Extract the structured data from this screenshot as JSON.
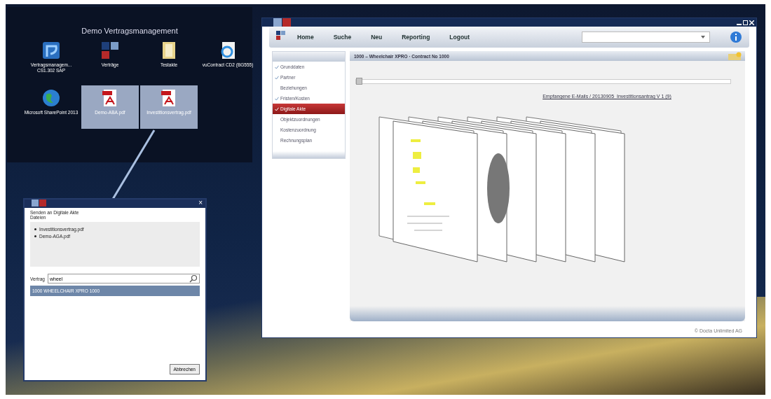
{
  "desktop": {
    "group_title": "Demo Vertragsmanagement",
    "icons": [
      {
        "label": "Vertragsmanagem... CS1.302 SAP",
        "kind": "app",
        "selected": false
      },
      {
        "label": "Verträge",
        "kind": "tiles",
        "selected": false
      },
      {
        "label": "Testakte",
        "kind": "folder",
        "selected": false
      },
      {
        "label": "vuContract CD2 (BG555)",
        "kind": "browser",
        "selected": false
      },
      {
        "label": "Microsoft SharePoint 2013",
        "kind": "globe",
        "selected": false
      },
      {
        "label": "Demo-ABA.pdf",
        "kind": "pdf",
        "selected": true
      },
      {
        "label": "Investitionsvertrag.pdf",
        "kind": "pdf",
        "selected": true
      }
    ]
  },
  "dialog": {
    "close": "×",
    "title": "Senden an Digitale Akte",
    "files_label": "Dateien",
    "files": [
      "Investitionsvertrag.pdf",
      "Demo-AGA.pdf"
    ],
    "contract_label": "Vertrag",
    "contract_value": "wheel",
    "results": [
      {
        "label": "1000 WHEELCHAIR XPRO 1000",
        "selected": true
      }
    ],
    "cancel_button": "Abbrechen"
  },
  "window": {
    "nav": [
      "Home",
      "Suche",
      "Neu",
      "Reporting",
      "Logout"
    ],
    "sidebar": [
      {
        "label": "Grunddaten",
        "checked": true,
        "selected": false
      },
      {
        "label": "Partner",
        "checked": true,
        "selected": false
      },
      {
        "label": "Beziehungen",
        "checked": false,
        "selected": false
      },
      {
        "label": "Fristen/Kosten",
        "checked": true,
        "selected": false
      },
      {
        "label": "Digitale Akte",
        "checked": true,
        "selected": true
      },
      {
        "label": "Objektzuordnungen",
        "checked": false,
        "selected": false
      },
      {
        "label": "Kostenzuordnung",
        "checked": false,
        "selected": false
      },
      {
        "label": "Rechnungsplan",
        "checked": false,
        "selected": false
      }
    ],
    "content": {
      "title": "1000 – Wheelchair XPRO · Contract No 1000",
      "slider": {
        "level": 0
      },
      "link": "Empfangene E-Mails / 20130905_Investitionsantrag V 1 (9)"
    },
    "footer": "© Docta Unlimited AG"
  }
}
